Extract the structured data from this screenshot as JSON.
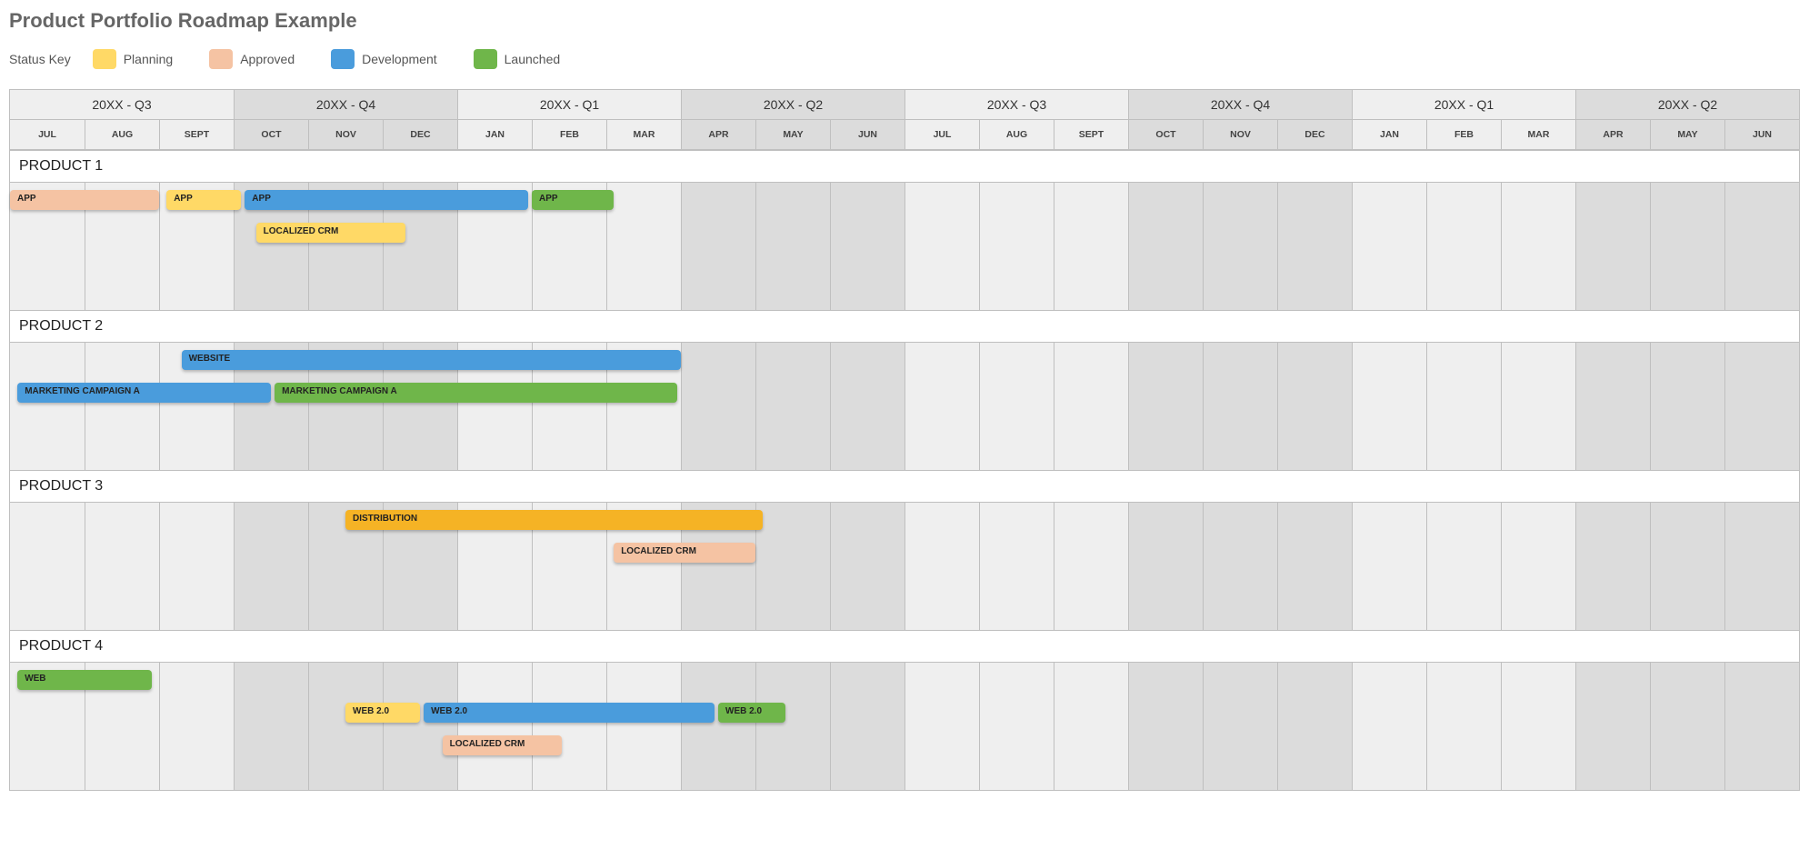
{
  "title": "Product Portfolio Roadmap Example",
  "legend": {
    "label": "Status Key",
    "items": [
      {
        "label": "Planning",
        "cls": "c-planning"
      },
      {
        "label": "Approved",
        "cls": "c-approved"
      },
      {
        "label": "Development",
        "cls": "c-development"
      },
      {
        "label": "Launched",
        "cls": "c-launched"
      }
    ]
  },
  "months_per_row": 24,
  "quarters": [
    {
      "label": "20XX - Q3",
      "span": 3,
      "shade": "a"
    },
    {
      "label": "20XX - Q4",
      "span": 3,
      "shade": "b"
    },
    {
      "label": "20XX - Q1",
      "span": 3,
      "shade": "a"
    },
    {
      "label": "20XX - Q2",
      "span": 3,
      "shade": "b"
    },
    {
      "label": "20XX - Q3",
      "span": 3,
      "shade": "a"
    },
    {
      "label": "20XX - Q4",
      "span": 3,
      "shade": "b"
    },
    {
      "label": "20XX - Q1",
      "span": 3,
      "shade": "a"
    },
    {
      "label": "20XX - Q2",
      "span": 3,
      "shade": "b"
    }
  ],
  "months": [
    "JUL",
    "AUG",
    "SEPT",
    "OCT",
    "NOV",
    "DEC",
    "JAN",
    "FEB",
    "MAR",
    "APR",
    "MAY",
    "JUN",
    "JUL",
    "AUG",
    "SEPT",
    "OCT",
    "NOV",
    "DEC",
    "JAN",
    "FEB",
    "MAR",
    "APR",
    "MAY",
    "JUN"
  ],
  "products": [
    {
      "name": "PRODUCT 1",
      "bars": [
        {
          "label": "APP",
          "start": 0.0,
          "span": 2.0,
          "row": 0,
          "cls": "c-approved"
        },
        {
          "label": "APP",
          "start": 2.1,
          "span": 1.0,
          "row": 0,
          "cls": "c-planning"
        },
        {
          "label": "APP",
          "start": 3.15,
          "span": 3.8,
          "row": 0,
          "cls": "c-development"
        },
        {
          "label": "APP",
          "start": 7.0,
          "span": 1.1,
          "row": 0,
          "cls": "c-launched"
        },
        {
          "label": "LOCALIZED CRM",
          "start": 3.3,
          "span": 2.0,
          "row": 1,
          "cls": "c-planning"
        }
      ]
    },
    {
      "name": "PRODUCT 2",
      "bars": [
        {
          "label": "WEBSITE",
          "start": 2.3,
          "span": 6.7,
          "row": 0,
          "cls": "c-development"
        },
        {
          "label": "MARKETING CAMPAIGN A",
          "start": 0.1,
          "span": 3.4,
          "row": 1,
          "cls": "c-development"
        },
        {
          "label": "MARKETING CAMPAIGN A",
          "start": 3.55,
          "span": 5.4,
          "row": 1,
          "cls": "c-launched"
        }
      ]
    },
    {
      "name": "PRODUCT 3",
      "bars": [
        {
          "label": "DISTRIBUTION",
          "start": 4.5,
          "span": 5.6,
          "row": 0,
          "cls": "c-dist"
        },
        {
          "label": "LOCALIZED CRM",
          "start": 8.1,
          "span": 1.9,
          "row": 1,
          "cls": "c-approved"
        }
      ]
    },
    {
      "name": "PRODUCT 4",
      "bars": [
        {
          "label": "WEB",
          "start": 0.1,
          "span": 1.8,
          "row": 0,
          "cls": "c-launched"
        },
        {
          "label": "WEB 2.0",
          "start": 4.5,
          "span": 1.0,
          "row": 1,
          "cls": "c-planning"
        },
        {
          "label": "WEB 2.0",
          "start": 5.55,
          "span": 3.9,
          "row": 1,
          "cls": "c-development"
        },
        {
          "label": "WEB 2.0",
          "start": 9.5,
          "span": 0.9,
          "row": 1,
          "cls": "c-launched"
        },
        {
          "label": "LOCALIZED CRM",
          "start": 5.8,
          "span": 1.6,
          "row": 2,
          "cls": "c-approved"
        }
      ]
    }
  ],
  "chart_data": {
    "type": "gantt",
    "title": "Product Portfolio Roadmap Example",
    "x_axis": {
      "unit": "month",
      "categories": [
        "JUL",
        "AUG",
        "SEPT",
        "OCT",
        "NOV",
        "DEC",
        "JAN",
        "FEB",
        "MAR",
        "APR",
        "MAY",
        "JUN",
        "JUL",
        "AUG",
        "SEPT",
        "OCT",
        "NOV",
        "DEC",
        "JAN",
        "FEB",
        "MAR",
        "APR",
        "MAY",
        "JUN"
      ],
      "quarters": [
        "20XX - Q3",
        "20XX - Q4",
        "20XX - Q1",
        "20XX - Q2",
        "20XX - Q3",
        "20XX - Q4",
        "20XX - Q1",
        "20XX - Q2"
      ]
    },
    "status_colors": {
      "Planning": "#ffd966",
      "Approved": "#f5c3a3",
      "Development": "#4a9cdc",
      "Launched": "#6fb64a"
    },
    "groups": [
      {
        "name": "PRODUCT 1",
        "tasks": [
          {
            "name": "APP",
            "status": "Approved",
            "start_month": 0,
            "duration_months": 2.0
          },
          {
            "name": "APP",
            "status": "Planning",
            "start_month": 2.1,
            "duration_months": 1.0
          },
          {
            "name": "APP",
            "status": "Development",
            "start_month": 3.15,
            "duration_months": 3.8
          },
          {
            "name": "APP",
            "status": "Launched",
            "start_month": 7.0,
            "duration_months": 1.1
          },
          {
            "name": "LOCALIZED CRM",
            "status": "Planning",
            "start_month": 3.3,
            "duration_months": 2.0
          }
        ]
      },
      {
        "name": "PRODUCT 2",
        "tasks": [
          {
            "name": "WEBSITE",
            "status": "Development",
            "start_month": 2.3,
            "duration_months": 6.7
          },
          {
            "name": "MARKETING CAMPAIGN A",
            "status": "Development",
            "start_month": 0.1,
            "duration_months": 3.4
          },
          {
            "name": "MARKETING CAMPAIGN A",
            "status": "Launched",
            "start_month": 3.55,
            "duration_months": 5.4
          }
        ]
      },
      {
        "name": "PRODUCT 3",
        "tasks": [
          {
            "name": "DISTRIBUTION",
            "status": "Planning",
            "start_month": 4.5,
            "duration_months": 5.6
          },
          {
            "name": "LOCALIZED CRM",
            "status": "Approved",
            "start_month": 8.1,
            "duration_months": 1.9
          }
        ]
      },
      {
        "name": "PRODUCT 4",
        "tasks": [
          {
            "name": "WEB",
            "status": "Launched",
            "start_month": 0.1,
            "duration_months": 1.8
          },
          {
            "name": "WEB 2.0",
            "status": "Planning",
            "start_month": 4.5,
            "duration_months": 1.0
          },
          {
            "name": "WEB 2.0",
            "status": "Development",
            "start_month": 5.55,
            "duration_months": 3.9
          },
          {
            "name": "WEB 2.0",
            "status": "Launched",
            "start_month": 9.5,
            "duration_months": 0.9
          },
          {
            "name": "LOCALIZED CRM",
            "status": "Approved",
            "start_month": 5.8,
            "duration_months": 1.6
          }
        ]
      }
    ]
  }
}
